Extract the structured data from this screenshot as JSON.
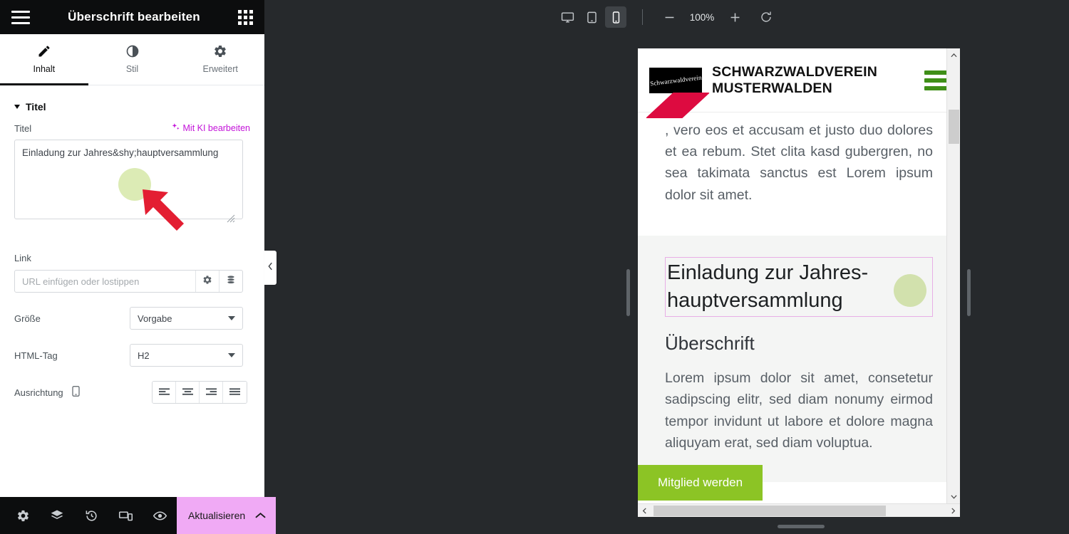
{
  "panel": {
    "header": {
      "title": "Überschrift bearbeiten",
      "menu_icon": "hamburger-icon",
      "apps_icon": "grid-icon"
    },
    "tabs": [
      {
        "label": "Inhalt",
        "icon": "pencil-icon",
        "active": true
      },
      {
        "label": "Stil",
        "icon": "contrast-icon",
        "active": false
      },
      {
        "label": "Erweitert",
        "icon": "gear-icon",
        "active": false
      }
    ],
    "section": {
      "label": "Titel",
      "expanded": true
    },
    "title_control": {
      "label": "Titel",
      "ai_label": "Mit KI bearbeiten",
      "ai_icon": "sparkles-icon",
      "value": "Einladung zur Jahres&shy;hauptversammlung"
    },
    "link_control": {
      "label": "Link",
      "placeholder": "URL einfügen oder lostippen",
      "value": "",
      "options_icon": "gear-icon",
      "dynamic_icon": "database-icon"
    },
    "size_control": {
      "label": "Größe",
      "value": "Vorgabe"
    },
    "tag_control": {
      "label": "HTML-Tag",
      "value": "H2"
    },
    "align_control": {
      "label": "Ausrichtung",
      "device_icon": "mobile-icon",
      "options": [
        "align-left",
        "align-center",
        "align-right",
        "align-justify"
      ]
    },
    "footer": {
      "icons": [
        "settings-icon",
        "layers-icon",
        "history-icon",
        "responsive-icon",
        "preview-icon"
      ],
      "publish_label": "Aktualisieren",
      "publish_chevron": "chevron-up-icon",
      "publish_color": "#f0aaf5"
    },
    "collapse_icon": "chevron-left-icon"
  },
  "topbar": {
    "devices": [
      {
        "name": "desktop-icon",
        "active": false
      },
      {
        "name": "tablet-icon",
        "active": false
      },
      {
        "name": "mobile-icon",
        "active": true
      }
    ],
    "zoom_out_icon": "minus-icon",
    "zoom_value": "100%",
    "zoom_in_icon": "plus-icon",
    "reset_icon": "reset-icon"
  },
  "preview": {
    "site_header": {
      "logo_text": "Schwarzwaldverein",
      "title_line1": "SCHWARZWALDVEREIN",
      "title_line2": "MUSTERWALDEN",
      "menu_icon": "hamburger-icon",
      "menu_color": "#3f8f18",
      "diamond_color": "#dd0b40"
    },
    "paragraph_top": ", vero eos et accusam et justo duo dolores et ea rebum. Stet clita kasd gubergren, no sea takimata sanctus est Lorem ipsum dolor sit amet.",
    "selected_heading": "Einladung zur Jahres­hauptversammlung",
    "subheading": "Überschrift",
    "paragraph_bottom": "Lorem ipsum dolor sit amet, consetetur sadipscing elitr, sed diam nonumy eirmod tempor invidunt ut labore et dolore magna aliquyam erat, sed diam voluptua.",
    "cta_label": "Mitglied werden",
    "cta_color": "#8cc425",
    "selection_color": "#e8aee6",
    "vscroll_up_icon": "chevron-up-icon",
    "vscroll_down_icon": "chevron-down-icon",
    "hscroll_left_icon": "chevron-left-icon",
    "hscroll_right_icon": "chevron-right-icon"
  }
}
